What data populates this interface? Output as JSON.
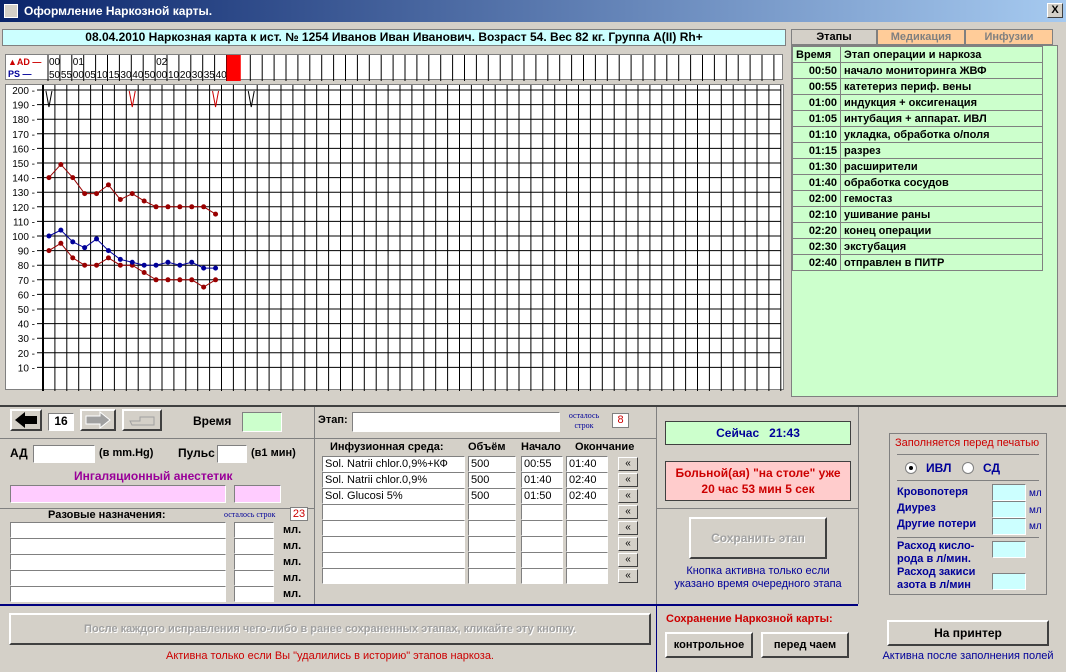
{
  "window": {
    "title": "Оформление Наркозной карты.",
    "close": "X"
  },
  "header": {
    "text": "08.04.2010     Наркозная карта к ист. № 1254  Иванов Иван Иванович.  Возраст 54.   Вес  82 кг.   Группа A(II) Rh+"
  },
  "legend": {
    "ad": "AD",
    "ps": "PS"
  },
  "time_cols": [
    {
      "top": "00",
      "bottom": "50"
    },
    {
      "top": "",
      "bottom": "55"
    },
    {
      "top": "01",
      "bottom": "00"
    },
    {
      "top": "",
      "bottom": "05"
    },
    {
      "top": "",
      "bottom": "10"
    },
    {
      "top": "",
      "bottom": "15"
    },
    {
      "top": "",
      "bottom": "30"
    },
    {
      "top": "",
      "bottom": "40"
    },
    {
      "top": "",
      "bottom": "50"
    },
    {
      "top": "02",
      "bottom": "00"
    },
    {
      "top": "",
      "bottom": "10"
    },
    {
      "top": "",
      "bottom": "20"
    },
    {
      "top": "",
      "bottom": "30"
    },
    {
      "top": "",
      "bottom": "35"
    },
    {
      "top": "",
      "bottom": "40"
    }
  ],
  "chart_data": {
    "type": "line",
    "yticks": [
      200,
      190,
      180,
      170,
      160,
      150,
      140,
      130,
      120,
      110,
      100,
      90,
      80,
      70,
      60,
      50,
      40,
      30,
      20,
      10
    ],
    "ylim": [
      0,
      205
    ],
    "grid": true,
    "x": [
      "00:50",
      "00:55",
      "01:00",
      "01:05",
      "01:10",
      "01:15",
      "01:30",
      "01:40",
      "01:50",
      "02:00",
      "02:10",
      "02:20",
      "02:30",
      "02:35",
      "02:40"
    ],
    "series": [
      {
        "name": "AD",
        "color": "#990000",
        "values": [
          140,
          149,
          140,
          129,
          129,
          135,
          125,
          129,
          124,
          120,
          120,
          120,
          120,
          120,
          115
        ]
      },
      {
        "name": "AD",
        "color": "#990000",
        "values": [
          90,
          95,
          85,
          80,
          80,
          85,
          80,
          80,
          75,
          70,
          70,
          70,
          70,
          65,
          70
        ]
      },
      {
        "name": "PS",
        "color": "#000099",
        "values": [
          100,
          104,
          96,
          92,
          98,
          90,
          84,
          82,
          80,
          80,
          82,
          80,
          82,
          78,
          78
        ]
      }
    ],
    "markers": [
      {
        "col": 0,
        "color": "#000000"
      },
      {
        "col": 7,
        "color": "#cc0000"
      },
      {
        "col": 14,
        "color": "#cc0000"
      },
      {
        "col": 17,
        "color": "#000000"
      }
    ]
  },
  "tabs": [
    {
      "label": "Этапы",
      "active": true
    },
    {
      "label": "Медикация",
      "active": false
    },
    {
      "label": "Инфузии",
      "active": false
    }
  ],
  "stages": {
    "col_time": "Время",
    "col_stage": "Этап операции и наркоза",
    "rows": [
      {
        "time": "00:50",
        "stage": "начало мониторинга ЖВФ"
      },
      {
        "time": "00:55",
        "stage": "катетериз периф. вены"
      },
      {
        "time": "01:00",
        "stage": "индукция + оксигенация"
      },
      {
        "time": "01:05",
        "stage": "интубация + аппарат. ИВЛ"
      },
      {
        "time": "01:10",
        "stage": "укладка, обработка о/поля"
      },
      {
        "time": "01:15",
        "stage": "разрез"
      },
      {
        "time": "01:30",
        "stage": "расширители"
      },
      {
        "time": "01:40",
        "stage": "обработка сосудов"
      },
      {
        "time": "02:00",
        "stage": "гемостаз"
      },
      {
        "time": "02:10",
        "stage": "ушивание раны"
      },
      {
        "time": "02:20",
        "stage": "конец операции"
      },
      {
        "time": "02:30",
        "stage": "экстубация"
      },
      {
        "time": "02:40",
        "stage": "отправлен в ПИТР"
      }
    ]
  },
  "nav": {
    "page": "16",
    "time_label": "Время",
    "time_value": ""
  },
  "vitals": {
    "ad_label": "АД",
    "ad_unit": "(в mm.Hg)",
    "ad_value": "",
    "pulse_label": "Пульс",
    "pulse_unit": "(в1 мин)",
    "pulse_value": ""
  },
  "anesthetic": {
    "label": "Ингаляционный анестетик",
    "name": "",
    "dose": ""
  },
  "single": {
    "label": "Разовые назначения:",
    "remaining_label": "осталось строк",
    "remaining": "23",
    "unit": "мл."
  },
  "stage_input": {
    "label": "Этап:",
    "value": "",
    "remaining_label": "осталось строк",
    "remaining": "8"
  },
  "infusion": {
    "headers": {
      "medium": "Инфузионная среда:",
      "volume": "Объём",
      "start": "Начало",
      "end": "Окончание"
    },
    "rows": [
      {
        "medium": "Sol. Natrii chlor.0,9%+КФ",
        "volume": "500",
        "start": "00:55",
        "end": "01:40"
      },
      {
        "medium": "Sol. Natrii chlor.0,9%",
        "volume": "500",
        "start": "01:40",
        "end": "02:40"
      },
      {
        "medium": "Sol. Glucosi 5%",
        "volume": "500",
        "start": "01:50",
        "end": "02:40"
      },
      {
        "medium": "",
        "volume": "",
        "start": "",
        "end": ""
      },
      {
        "medium": "",
        "volume": "",
        "start": "",
        "end": ""
      },
      {
        "medium": "",
        "volume": "",
        "start": "",
        "end": ""
      },
      {
        "medium": "",
        "volume": "",
        "start": "",
        "end": ""
      },
      {
        "medium": "",
        "volume": "",
        "start": "",
        "end": ""
      }
    ],
    "arrow": "«"
  },
  "now": {
    "label": "Сейчас",
    "time": "21:43"
  },
  "on_table": {
    "line1": "Больной(ая) \"на столе\" уже",
    "line2": "20 час 53 мин 5 сек"
  },
  "save_stage": {
    "label": "Сохранить этап",
    "hint1": "Кнопка активна только если",
    "hint2": "указано время очередного этапа"
  },
  "print_panel": {
    "title": "Заполняется перед печатью",
    "ivl": "ИВЛ",
    "sd": "СД",
    "blood_loss": "Кровопотеря",
    "diuresis": "Диурез",
    "other_loss": "Другие потери",
    "unit": "мл",
    "o2_line1": "Расход кисло-",
    "o2_line2": "рода в л/мин.",
    "n2o_line1": "Расход закиси",
    "n2o_line2": "азота в л/мин"
  },
  "bottom": {
    "fix_button": "После каждого исправления чего-либо в ранее сохраненных этапах, кликайте эту кнопку.",
    "fix_hint": "Активна только если Вы \"удалились в историю\" этапов наркоза.",
    "save_card_label": "Сохранение Наркозной карты:",
    "control": "контрольное",
    "before_tea": "перед чаем",
    "printer": "На принтер",
    "printer_hint": "Активна после заполнения полей"
  }
}
